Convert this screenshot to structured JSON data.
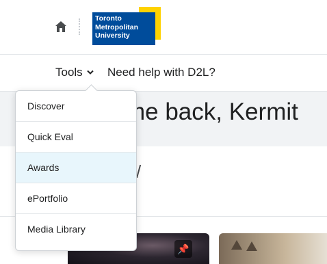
{
  "header": {
    "logo_lines": [
      "Toronto",
      "Metropolitan",
      "University"
    ],
    "home_icon": "home-icon"
  },
  "nav": {
    "tools_label": "Tools",
    "help_label": "Need help with D2L?"
  },
  "main": {
    "welcome_text": "me back, Kermit",
    "panel_mark": "/"
  },
  "dropdown": {
    "items": [
      {
        "label": "Discover"
      },
      {
        "label": "Quick Eval"
      },
      {
        "label": "Awards",
        "active": true
      },
      {
        "label": "ePortfolio"
      },
      {
        "label": "Media Library"
      }
    ]
  },
  "colors": {
    "brand_blue": "#004c9b",
    "brand_yellow": "#ffd200",
    "active_item_bg": "#e8f6fc"
  }
}
